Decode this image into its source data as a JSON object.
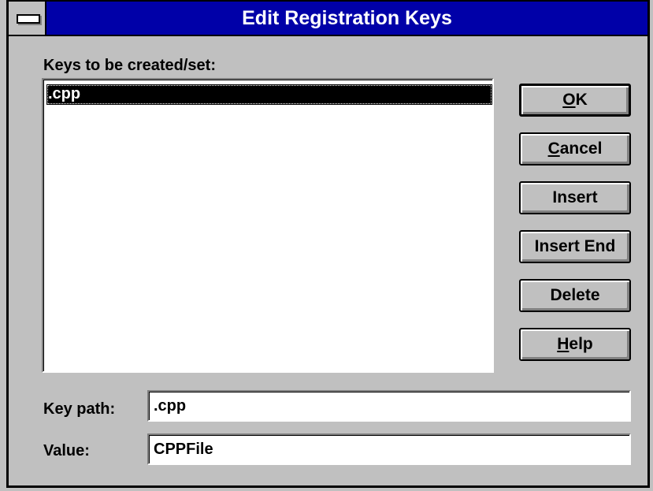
{
  "window": {
    "title": "Edit Registration Keys"
  },
  "keys_label": "Keys to be created/set:",
  "keys_list": {
    "items": [
      ".cpp"
    ],
    "selected": ".cpp"
  },
  "buttons": {
    "ok": {
      "mnemonic": "O",
      "rest": "K"
    },
    "cancel": {
      "mnemonic": "C",
      "rest": "ancel"
    },
    "insert": "Insert",
    "insert_end": "Insert End",
    "delete": "Delete",
    "help": {
      "mnemonic": "H",
      "rest": "elp"
    }
  },
  "key_path": {
    "label": "Key path:",
    "value": ".cpp"
  },
  "value": {
    "label": "Value:",
    "value": "CPPFile"
  },
  "colors": {
    "face": "#c0c0c0",
    "titlebar": "#0000a8",
    "selection": "#000000"
  }
}
